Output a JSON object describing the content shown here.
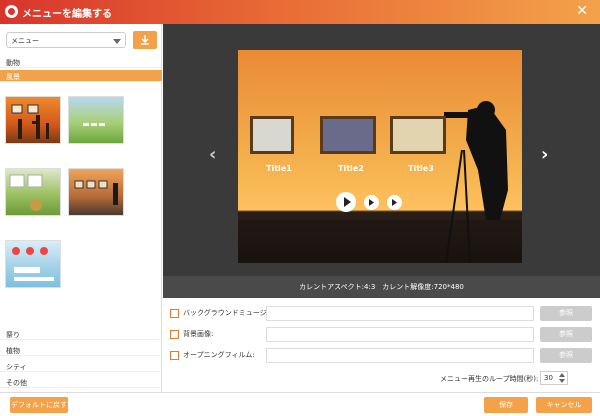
{
  "window": {
    "title": "メニューを編集する",
    "close": "✕"
  },
  "sidebar": {
    "menu_select": "メニュー",
    "categories_top": [
      "動物",
      "風景"
    ],
    "active_category": "風景",
    "categories_bottom": [
      "祭り",
      "植物",
      "シティ",
      "その他"
    ]
  },
  "preview": {
    "titles": [
      "Title1",
      "Title2",
      "Title3"
    ],
    "prev_arrow": "‹",
    "next_arrow": "›"
  },
  "info": {
    "text": "カレントアスペクト:4:3　カレント解像度:720*480"
  },
  "options": [
    {
      "label": "バックグラウンドミュージック:",
      "browse": "参照"
    },
    {
      "label": "背景画像:",
      "browse": "参照"
    },
    {
      "label": "オープニングフィルム:",
      "browse": "参照"
    }
  ],
  "loop": {
    "label": "メニュー再生のループ時間(秒):",
    "value": "30"
  },
  "footer": {
    "reset": "デフォルトに戻す",
    "save": "保存",
    "cancel": "キャンセル"
  },
  "colors": {
    "accent": "#f3a24a",
    "titlebar_start": "#d8352c"
  }
}
